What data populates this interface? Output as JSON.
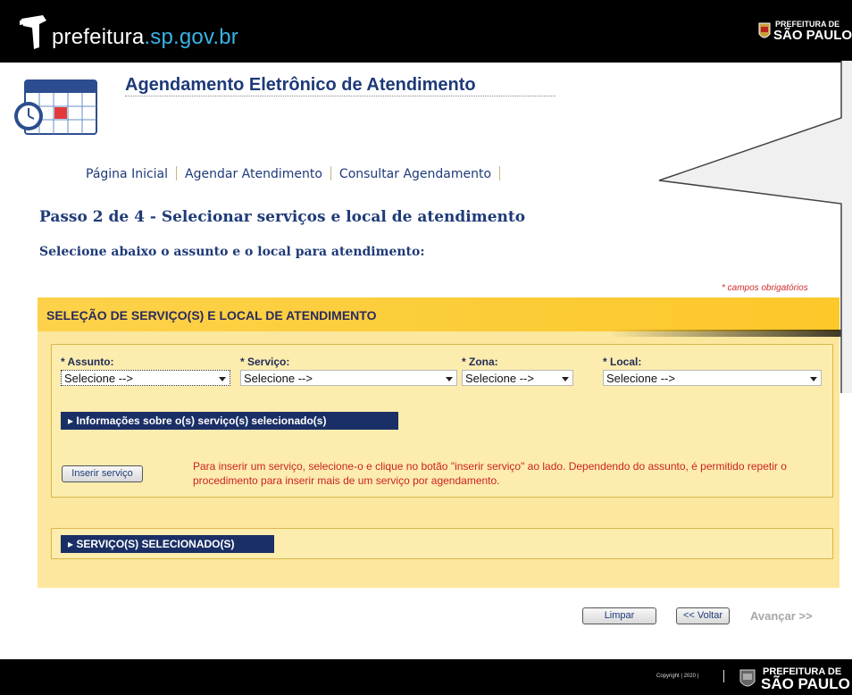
{
  "header": {
    "site_name_prefix": "prefeitura",
    "site_name_domain": ".sp.gov.br",
    "badge_line1": "PREFEITURA DE",
    "badge_line2": "SÃO PAULO"
  },
  "app": {
    "title": "Agendamento Eletrônico de Atendimento"
  },
  "nav": {
    "items": [
      "Página Inicial",
      "Agendar Atendimento",
      "Consultar Agendamento"
    ]
  },
  "page": {
    "step_title": "Passo 2 de 4 - Selecionar serviços e local de atendimento",
    "step_subtitle": "Selecione abaixo o assunto e o local para atendimento:",
    "required_note": "* campos obrigatórios"
  },
  "panel": {
    "title": "SELEÇÃO DE SERVIÇO(S) E LOCAL DE ATENDIMENTO",
    "fields": {
      "assunto": {
        "label": "* Assunto:",
        "value": "Selecione -->"
      },
      "servico": {
        "label": "* Serviço:",
        "value": "Selecione -->"
      },
      "zona": {
        "label": "* Zona:",
        "value": "Selecione -->"
      },
      "local": {
        "label": "* Local:",
        "value": "Selecione -->"
      }
    },
    "info_toggle": "▸ Informações sobre o(s) serviço(s) selecionado(s)",
    "insert_button": "Inserir serviço",
    "insert_note": "Para inserir um serviço, selecione-o e clique no botão \"inserir serviço\" ao lado. Dependendo do assunto, é permitido repetir o procedimento para inserir mais de um serviço por agendamento.",
    "selected_toggle": "▸ SERVIÇO(S) SELECIONADO(S)"
  },
  "actions": {
    "clear": "Limpar",
    "back": "<< Voltar",
    "next": "Avançar >>"
  },
  "footer": {
    "copyright": "Copyright | 2020 |",
    "badge_line1": "PREFEITURA DE",
    "badge_line2": "SÃO PAULO"
  },
  "colors": {
    "brand_navy": "#1e3a78",
    "panel_yellow": "#fbe79d",
    "header_yellow": "#fcc82a",
    "alert_red": "#cc2222",
    "domain_blue": "#39b2e6"
  }
}
